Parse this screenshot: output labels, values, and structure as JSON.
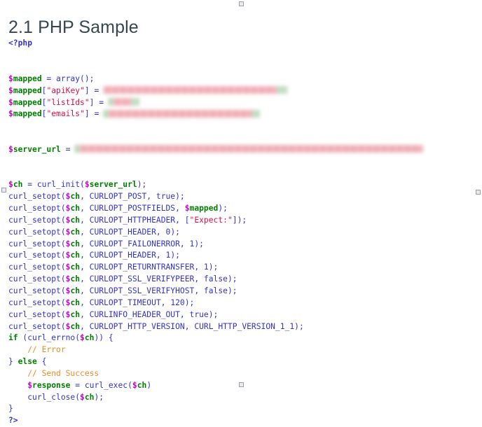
{
  "document": {
    "title": "2.1 PHP Sample",
    "language": "php"
  },
  "colors": {
    "title": "#37474f",
    "tag": "#3333cc",
    "variable": "#008000",
    "sigil": "#cc00cc",
    "constant": "#3333cc",
    "string": "#dd1144",
    "comment": "#f08a24",
    "keyword": "#008000",
    "redaction": "#dd4455",
    "background": "#ffffff"
  },
  "crop_marks": [
    {
      "name": "crop-mark-top",
      "position": "top-center"
    },
    {
      "name": "crop-mark-bottom",
      "position": "bottom-center"
    },
    {
      "name": "crop-mark-left",
      "position": "left-middle"
    },
    {
      "name": "crop-mark-right",
      "position": "right-middle"
    }
  ],
  "code": {
    "open_tag": "<?php",
    "close_tag": "?>",
    "lines": {
      "mapped_init": "$mapped = array();",
      "mapped_apikey_lhs": "$mapped[\"apiKey\"] =",
      "mapped_listids_lhs": "$mapped[\"listIds\"] =",
      "mapped_emails_lhs": "$mapped[\"emails\"] =",
      "server_url_lhs": "$server_url =",
      "ch_init": "$ch = curl_init($server_url);",
      "if_errno": "if (curl_errno($ch)) {",
      "comment_error": "// Error",
      "else_open": "} else {",
      "comment_success": "// Send Success",
      "response_exec": "$response = curl_exec($ch)",
      "curl_close": "curl_close($ch);",
      "brace_close": "}"
    },
    "redacted_values": [
      {
        "name": "redacted-apikey-value",
        "label": "apiKey",
        "redacted": true
      },
      {
        "name": "redacted-listids-value",
        "label": "listIds",
        "redacted": true
      },
      {
        "name": "redacted-emails-value",
        "label": "emails",
        "redacted": true
      },
      {
        "name": "redacted-server-url",
        "label": "server_url",
        "redacted": true
      }
    ],
    "setopt_calls": [
      {
        "fn": "curl_setopt",
        "handle": "$ch",
        "option": "CURLOPT_POST",
        "value": "true",
        "value_type": "bool"
      },
      {
        "fn": "curl_setopt",
        "handle": "$ch",
        "option": "CURLOPT_POSTFIELDS",
        "value": "$mapped",
        "value_type": "var"
      },
      {
        "fn": "curl_setopt",
        "handle": "$ch",
        "option": "CURLOPT_HTTPHEADER",
        "value": "[\"Expect:\"]",
        "value_type": "array"
      },
      {
        "fn": "curl_setopt",
        "handle": "$ch",
        "option": "CURLOPT_HEADER",
        "value": "0",
        "value_type": "num"
      },
      {
        "fn": "curl_setopt",
        "handle": "$ch",
        "option": "CURLOPT_FAILONERROR",
        "value": "1",
        "value_type": "num"
      },
      {
        "fn": "curl_setopt",
        "handle": "$ch",
        "option": "CURLOPT_HEADER",
        "value": "1",
        "value_type": "num"
      },
      {
        "fn": "curl_setopt",
        "handle": "$ch",
        "option": "CURLOPT_RETURNTRANSFER",
        "value": "1",
        "value_type": "num"
      },
      {
        "fn": "curl_setopt",
        "handle": "$ch",
        "option": "CURLOPT_SSL_VERIFYPEER",
        "value": "false",
        "value_type": "bool"
      },
      {
        "fn": "curl_setopt",
        "handle": "$ch",
        "option": "CURLOPT_SSL_VERIFYHOST",
        "value": "false",
        "value_type": "bool"
      },
      {
        "fn": "curl_setopt",
        "handle": "$ch",
        "option": "CURLOPT_TIMEOUT",
        "value": "120",
        "value_type": "num"
      },
      {
        "fn": "curl_setopt",
        "handle": "$ch",
        "option": "CURLINFO_HEADER_OUT",
        "value": "true",
        "value_type": "bool"
      },
      {
        "fn": "curl_setopt",
        "handle": "$ch",
        "option": "CURLOPT_HTTP_VERSION",
        "value": "CURL_HTTP_VERSION_1_1",
        "value_type": "const"
      }
    ],
    "string_literal_expect": "\"Expect:\""
  }
}
